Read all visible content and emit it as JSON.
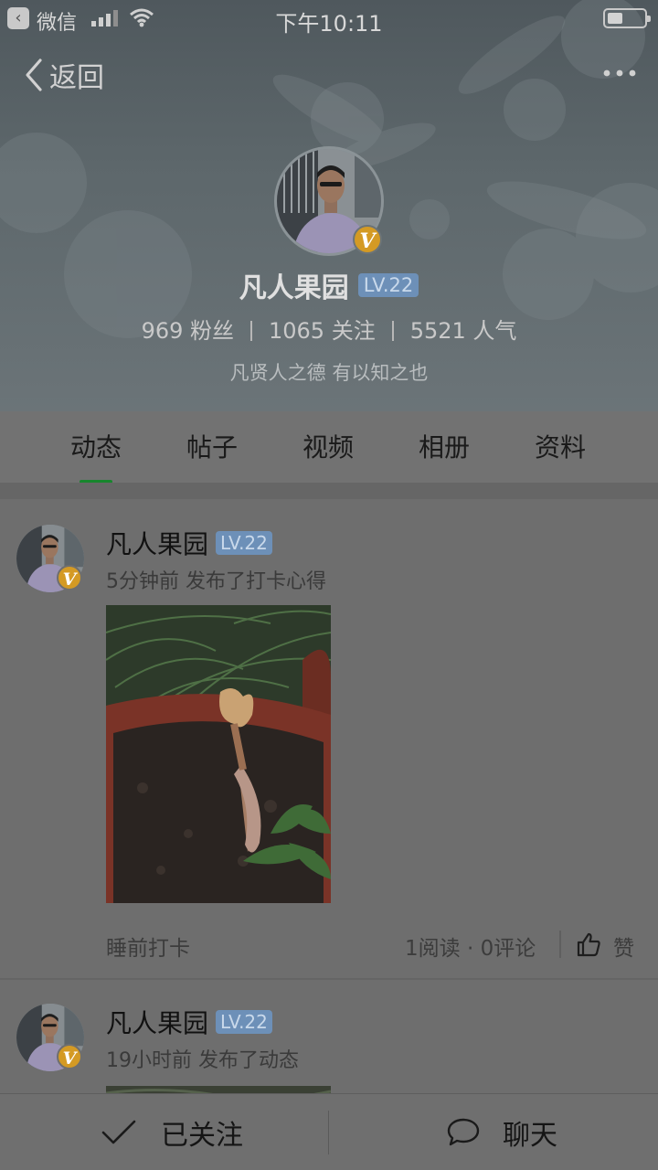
{
  "statusbar": {
    "back_app": "微信",
    "time": "下午10:11"
  },
  "nav": {
    "back_label": "返回"
  },
  "profile": {
    "name": "凡人果园",
    "level": "LV.22",
    "verified_badge": "V",
    "stats": {
      "fans": "969 粉丝",
      "following": "1065 关注",
      "popularity": "5521 人气"
    },
    "motto": "凡贤人之德  有以知之也"
  },
  "tabs": [
    {
      "label": "动态",
      "active": true
    },
    {
      "label": "帖子",
      "active": false
    },
    {
      "label": "视频",
      "active": false
    },
    {
      "label": "相册",
      "active": false
    },
    {
      "label": "资料",
      "active": false
    }
  ],
  "posts": [
    {
      "name": "凡人果园",
      "level": "LV.22",
      "meta": "5分钟前 发布了打卡心得",
      "caption": "睡前打卡",
      "stats": "1阅读 · 0评论",
      "like_label": "赞"
    },
    {
      "name": "凡人果园",
      "level": "LV.22",
      "meta": "19小时前 发布了动态"
    }
  ],
  "bottombar": {
    "follow_label": "已关注",
    "chat_label": "聊天"
  },
  "colors": {
    "accent_green": "#17862d",
    "level_badge": "#6d90b8",
    "verified_badge": "#d49a24",
    "overlay_gray": "#6e6e6e"
  },
  "icons": [
    "back-app-icon",
    "signal-icon",
    "wifi-icon",
    "battery-icon",
    "back-chevron-icon",
    "more-icon",
    "verified-icon",
    "like-icon",
    "check-icon",
    "chat-bubble-icon"
  ]
}
